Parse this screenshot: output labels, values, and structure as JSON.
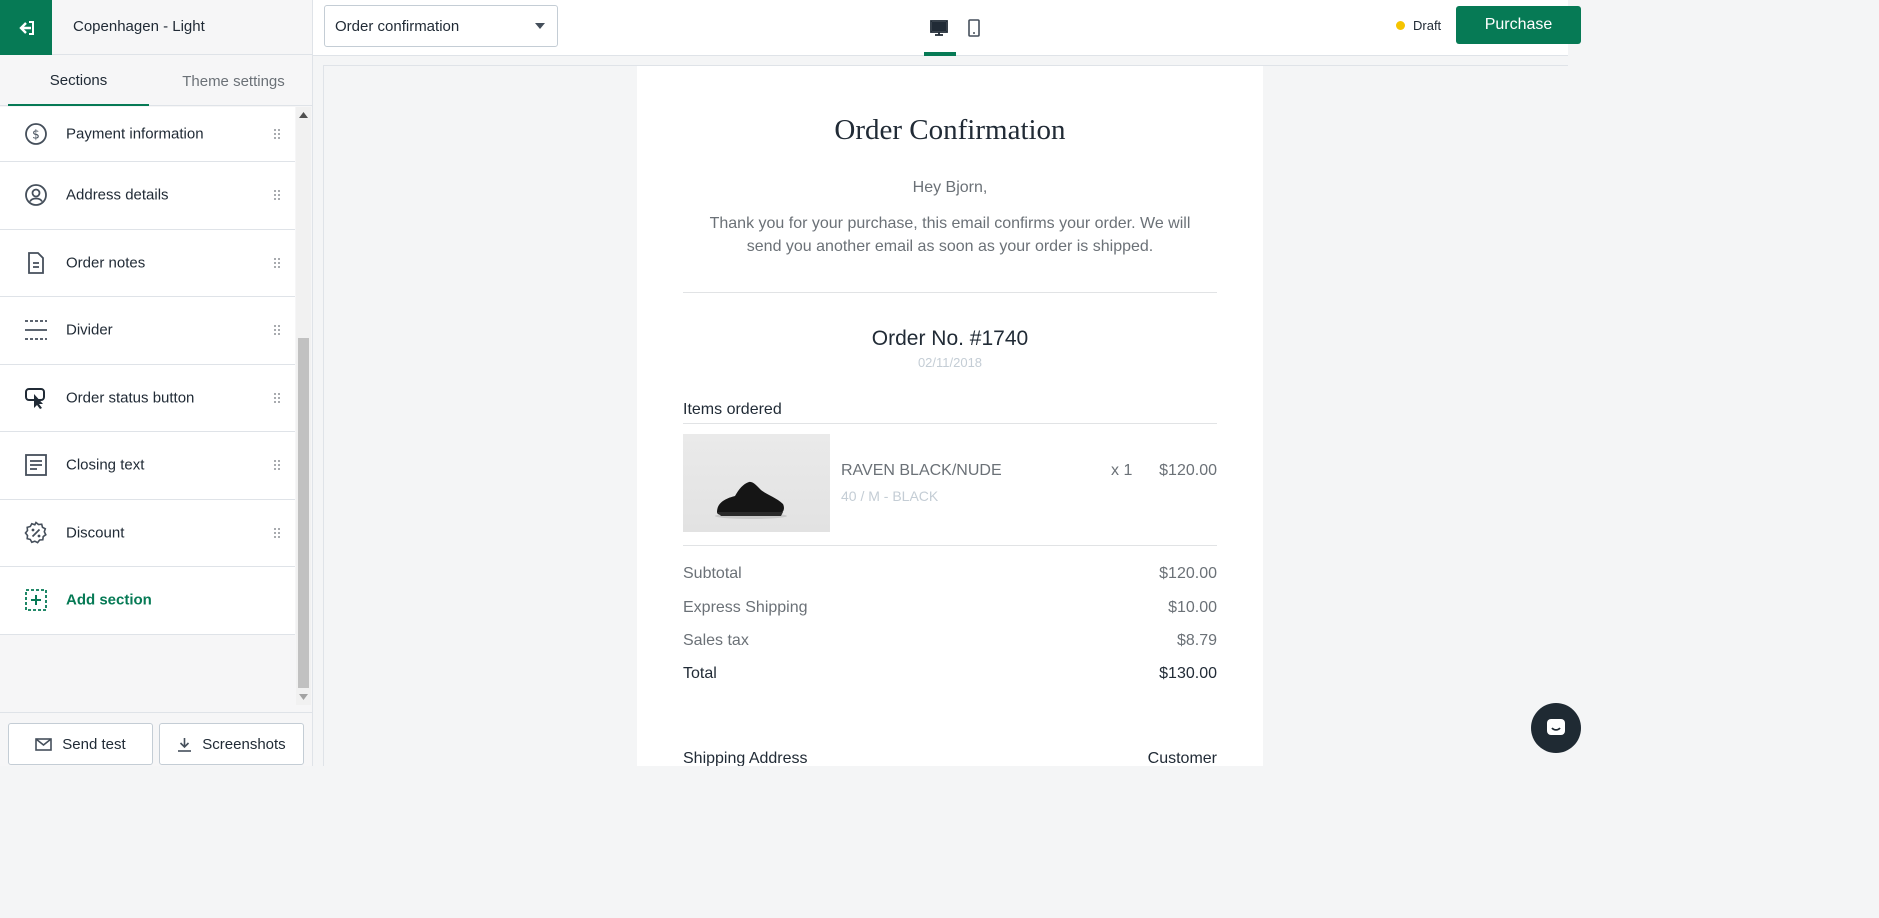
{
  "sidebar": {
    "theme_name": "Copenhagen - Light",
    "tabs": [
      {
        "label": "Sections"
      },
      {
        "label": "Theme settings"
      }
    ],
    "items": [
      {
        "label": "Payment information",
        "icon": "dollar-circle-icon"
      },
      {
        "label": "Address details",
        "icon": "user-circle-icon"
      },
      {
        "label": "Order notes",
        "icon": "document-icon"
      },
      {
        "label": "Divider",
        "icon": "divider-icon"
      },
      {
        "label": "Order status button",
        "icon": "button-icon"
      },
      {
        "label": "Closing text",
        "icon": "text-block-icon"
      },
      {
        "label": "Discount",
        "icon": "discount-icon"
      }
    ],
    "add_section": "Add section",
    "send_test": "Send test",
    "screenshots": "Screenshots"
  },
  "topbar": {
    "template_select": "Order confirmation",
    "status": "Draft",
    "purchase": "Purchase"
  },
  "email": {
    "title": "Order Confirmation",
    "greeting": "Hey Bjorn,",
    "body": "Thank you for your purchase, this email confirms your order. We will send you another email as soon as your order is shipped.",
    "order_no": "Order No. #1740",
    "order_date": "02/11/2018",
    "items_heading": "Items ordered",
    "product": {
      "name": "RAVEN BLACK/NUDE",
      "variant": "40 / M - BLACK",
      "qty": "x 1",
      "price": "$120.00"
    },
    "totals": [
      {
        "label": "Subtotal",
        "value": "$120.00"
      },
      {
        "label": "Express Shipping",
        "value": "$10.00"
      },
      {
        "label": "Sales tax",
        "value": "$8.79"
      },
      {
        "label": "Total",
        "value": "$130.00"
      }
    ],
    "shipping_heading": "Shipping Address",
    "shipping_right": "Customer"
  },
  "colors": {
    "accent": "#067a55",
    "draft_dot": "#f5c400"
  }
}
